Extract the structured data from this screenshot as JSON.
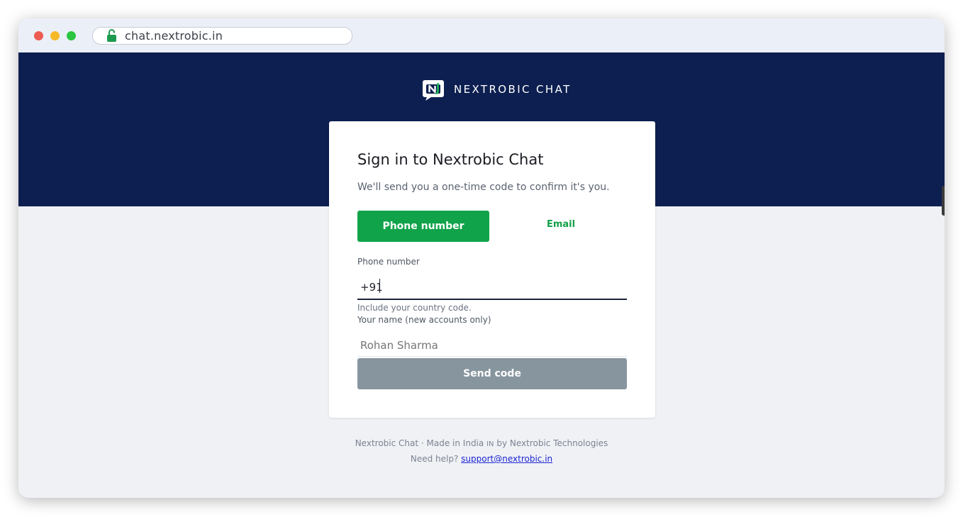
{
  "browser": {
    "url": "chat.nextrobic.in",
    "icons": [
      "lock-icon"
    ]
  },
  "brand": {
    "name": "NEXTROBIC CHAT",
    "logo_letter": "N"
  },
  "signin": {
    "title": "Sign in to Nextrobic Chat",
    "subtitle": "We'll send you a one-time code to confirm it's you.",
    "tabs": {
      "phone": "Phone number",
      "email": "Email",
      "active": "phone"
    },
    "phone_label": "Phone number",
    "phone_value": "+91",
    "phone_hint": "Include your country code.",
    "name_label": "Your name (new accounts only)",
    "name_placeholder": "Rohan Sharma",
    "send_button": "Send code"
  },
  "footer": {
    "line1_prefix": "Nextrobic Chat · Made in India",
    "line1_flag": "IN",
    "line1_suffix": "by Nextrobic Technologies",
    "help_prefix": "Need help?",
    "help_email": "support@nextrobic.in"
  },
  "colors": {
    "hero": "#0d1f50",
    "accent_green": "#11a34a",
    "button_disabled": "#87959e",
    "page_bg": "#f0f1f5"
  }
}
